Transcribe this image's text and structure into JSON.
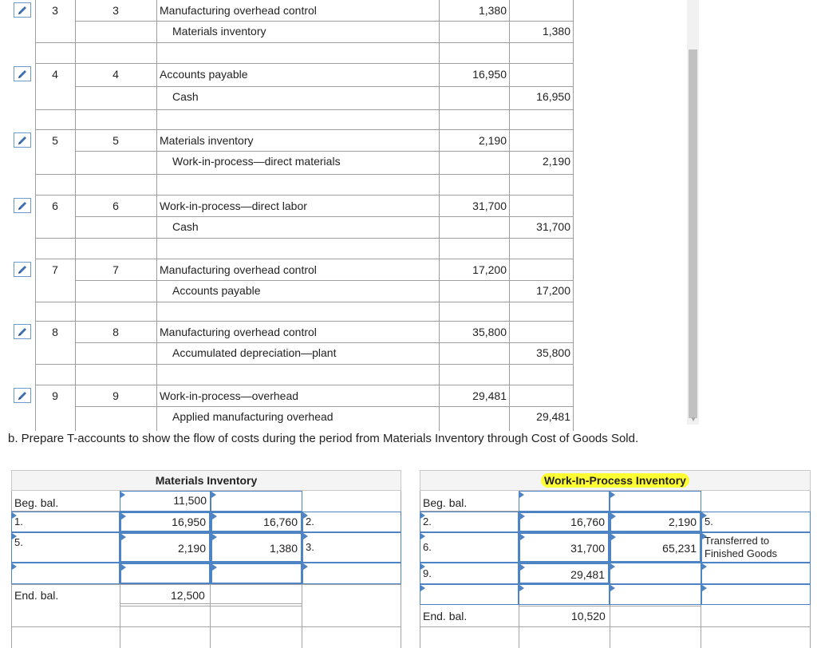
{
  "journal": {
    "entries": [
      {
        "no_a": "3",
        "no_b": "3",
        "debit_account": "Manufacturing overhead control",
        "debit": "1,380",
        "credit_account": "Materials inventory",
        "credit": "1,380"
      },
      {
        "no_a": "4",
        "no_b": "4",
        "debit_account": "Accounts payable",
        "debit": "16,950",
        "credit_account": "Cash",
        "credit": "16,950"
      },
      {
        "no_a": "5",
        "no_b": "5",
        "debit_account": "Materials inventory",
        "debit": "2,190",
        "credit_account": "Work-in-process—direct materials",
        "credit": "2,190"
      },
      {
        "no_a": "6",
        "no_b": "6",
        "debit_account": "Work-in-process—direct labor",
        "debit": "31,700",
        "credit_account": "Cash",
        "credit": "31,700"
      },
      {
        "no_a": "7",
        "no_b": "7",
        "debit_account": "Manufacturing overhead control",
        "debit": "17,200",
        "credit_account": "Accounts payable",
        "credit": "17,200"
      },
      {
        "no_a": "8",
        "no_b": "8",
        "debit_account": "Manufacturing overhead control",
        "debit": "35,800",
        "credit_account": "Accumulated depreciation—plant",
        "credit": "35,800"
      },
      {
        "no_a": "9",
        "no_b": "9",
        "debit_account": "Work-in-process—overhead",
        "debit": "29,481",
        "credit_account": "Applied manufacturing overhead",
        "credit": "29,481"
      }
    ],
    "edit_icon": "pencil-icon"
  },
  "instruction": "b. Prepare T-accounts to show the flow of costs during the period from Materials Inventory through Cost of Goods Sold.",
  "t_accounts": {
    "materials": {
      "title": "Materials Inventory",
      "beg_label": "Beg. bal.",
      "beg_value": "11,500",
      "row1_ref": "1.",
      "row1_debit": "16,950",
      "row1_credit": "16,760",
      "row1_credit_ref": "2.",
      "row2_ref": "5.",
      "row2_debit": "2,190",
      "row2_credit": "1,380",
      "row2_credit_ref": "3.",
      "end_label": "End. bal.",
      "end_value": "12,500"
    },
    "wip": {
      "title": "Work-In-Process Inventory",
      "highlight_color": "#ffff33",
      "beg_label": "Beg. bal.",
      "row1_ref": "2.",
      "row1_debit": "16,760",
      "row1_credit": "2,190",
      "row1_credit_ref": "5.",
      "row2_ref": "6.",
      "row2_debit": "31,700",
      "row2_credit": "65,231",
      "row2_credit_ref": "Transferred to Finished Goods",
      "row3_ref": "9.",
      "row3_debit": "29,481",
      "end_label": "End. bal.",
      "end_value": "10,520"
    }
  },
  "colors": {
    "accent": "#4f84c4",
    "grid": "#9e9e9e"
  }
}
